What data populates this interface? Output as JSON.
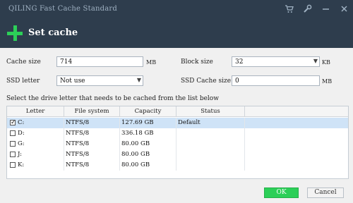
{
  "window": {
    "title": "QILING Fast Cache Standard"
  },
  "titlebar_icons": [
    {
      "name": "cart-icon",
      "glyph": "🛒"
    },
    {
      "name": "wrench-icon",
      "glyph": "🔧"
    },
    {
      "name": "minimize-icon",
      "glyph": "—"
    },
    {
      "name": "close-icon",
      "glyph": "✕"
    }
  ],
  "header": {
    "title": "Set cache"
  },
  "form": {
    "cache_size": {
      "label": "Cache size",
      "value": "714",
      "unit": "MB"
    },
    "block_size": {
      "label": "Block size",
      "value": "32",
      "unit": "KB"
    },
    "ssd_letter": {
      "label": "SSD letter",
      "value": "Not use"
    },
    "ssd_cache_size": {
      "label": "SSD Cache size",
      "value": "0",
      "unit": "MB"
    }
  },
  "prompt": "Select the drive letter that needs to be cached from the list below",
  "table": {
    "headers": [
      "Letter",
      "File system",
      "Capacity",
      "Status"
    ],
    "rows": [
      {
        "letter": "C:",
        "fs": "NTFS/8",
        "capacity": "127.69 GB",
        "status": "Default",
        "checked": true
      },
      {
        "letter": "D:",
        "fs": "NTFS/8",
        "capacity": "336.18 GB",
        "status": "",
        "checked": false
      },
      {
        "letter": "G:",
        "fs": "NTFS/8",
        "capacity": "80.00 GB",
        "status": "",
        "checked": false
      },
      {
        "letter": "J:",
        "fs": "NTFS/8",
        "capacity": "80.00 GB",
        "status": "",
        "checked": false
      },
      {
        "letter": "K:",
        "fs": "NTFS/8",
        "capacity": "80.00 GB",
        "status": "",
        "checked": false
      }
    ]
  },
  "buttons": {
    "ok": "OK",
    "cancel": "Cancel"
  },
  "colors": {
    "accent": "#2ccf58",
    "titlebar": "#2e3d4d",
    "selection": "#cfe3f7"
  }
}
